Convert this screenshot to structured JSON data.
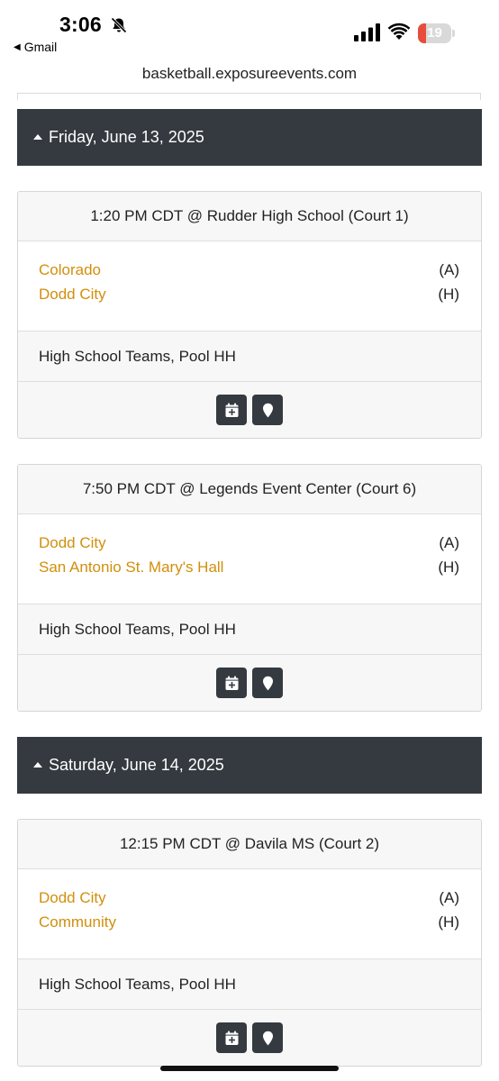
{
  "status_bar": {
    "time": "3:06",
    "back_app": "Gmail",
    "battery_level": "19",
    "battery_fraction": 0.19
  },
  "browser": {
    "url": "basketball.exposureevents.com"
  },
  "days": [
    {
      "date": "Friday, June 13, 2025",
      "games": [
        {
          "header": "1:20 PM CDT @ Rudder High School (Court 1)",
          "away_team": "Colorado",
          "away_tag": "(A)",
          "home_team": "Dodd City",
          "home_tag": "(H)",
          "division": "High School Teams, Pool HH"
        },
        {
          "header": "7:50 PM CDT @ Legends Event Center (Court 6)",
          "away_team": "Dodd City",
          "away_tag": "(A)",
          "home_team": "San Antonio St. Mary's Hall",
          "home_tag": "(H)",
          "division": "High School Teams, Pool HH"
        }
      ]
    },
    {
      "date": "Saturday, June 14, 2025",
      "games": [
        {
          "header": "12:15 PM CDT @ Davila MS (Court 2)",
          "away_team": "Dodd City",
          "away_tag": "(A)",
          "home_team": "Community",
          "home_tag": "(H)",
          "division": "High School Teams, Pool HH"
        }
      ]
    }
  ],
  "icons": {
    "calendar": "calendar-add-icon",
    "location": "map-marker-icon"
  },
  "colors": {
    "header_bg": "#343a40",
    "team_link": "#d18f0c",
    "card_bg": "#f7f7f7",
    "battery_low": "#e84c3d"
  }
}
